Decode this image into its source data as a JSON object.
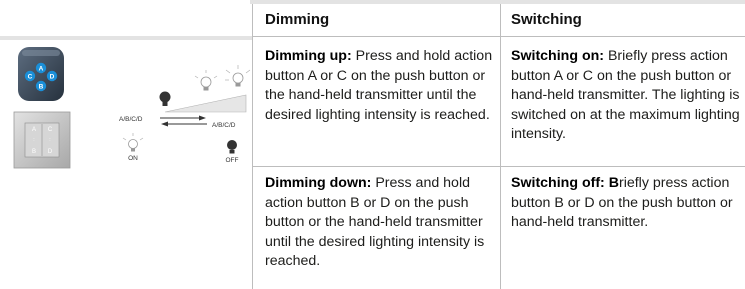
{
  "table": {
    "headers": {
      "dimming": "Dimming",
      "switching": "Switching"
    },
    "rows": [
      {
        "dimming": {
          "title": "Dimming up:",
          "text": " Press and hold action button A or C on the push button or the hand-held transmitter until the desired lighting intensity is reached."
        },
        "switching": {
          "title": "Switching on:",
          "text": " Briefly press action button A or C on the push button or hand-held transmitter. The lighting is switched on at the maximum lighting intensity."
        }
      },
      {
        "dimming": {
          "title": "Dimming down:",
          "text": " Press and hold action button B or D on the push button or the hand-held transmitter until the desired lighting intensity is reached."
        },
        "switching": {
          "title": "Switching off: B",
          "text": "riefly press action button B or D on the push button or hand-held transmitter."
        }
      }
    ]
  },
  "illustration": {
    "remote_buttons": [
      "A",
      "C",
      "D",
      "B"
    ],
    "switch_buttons": [
      "A",
      "C",
      "B",
      "D"
    ],
    "arrow_up_label": "A/B/C/D",
    "arrow_down_label": "A/B/C/D",
    "on_label": "ON",
    "off_label": "OFF",
    "accent_color": "#1a8fd8",
    "remote_color": "#3a4a5c",
    "bulb_dark_color": "#333333",
    "bulb_light_color": "#c8c8c8"
  }
}
